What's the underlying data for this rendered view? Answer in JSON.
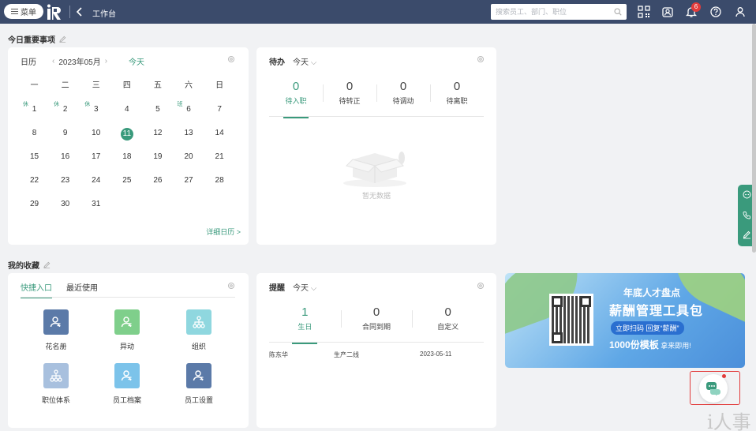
{
  "topbar": {
    "menu_label": "菜单",
    "breadcrumb": "工作台",
    "search_placeholder": "搜索员工、部门、职位",
    "notification_count": "6"
  },
  "sections": {
    "important": "今日重要事项",
    "favorites": "我的收藏"
  },
  "calendar": {
    "title": "日历",
    "month": "2023年05月",
    "today_label": "今天",
    "weekdays": [
      "一",
      "二",
      "三",
      "四",
      "五",
      "六",
      "日"
    ],
    "weeks": [
      [
        {
          "d": "1",
          "tag": "休"
        },
        {
          "d": "2",
          "tag": "休"
        },
        {
          "d": "3",
          "tag": "休"
        },
        {
          "d": "4"
        },
        {
          "d": "5"
        },
        {
          "d": "6",
          "tag": "班"
        },
        {
          "d": "7"
        }
      ],
      [
        {
          "d": "8"
        },
        {
          "d": "9"
        },
        {
          "d": "10"
        },
        {
          "d": "11",
          "today": true
        },
        {
          "d": "12"
        },
        {
          "d": "13"
        },
        {
          "d": "14"
        }
      ],
      [
        {
          "d": "15"
        },
        {
          "d": "16"
        },
        {
          "d": "17"
        },
        {
          "d": "18"
        },
        {
          "d": "19"
        },
        {
          "d": "20"
        },
        {
          "d": "21"
        }
      ],
      [
        {
          "d": "22"
        },
        {
          "d": "23"
        },
        {
          "d": "24"
        },
        {
          "d": "25"
        },
        {
          "d": "26"
        },
        {
          "d": "27"
        },
        {
          "d": "28"
        }
      ],
      [
        {
          "d": "29"
        },
        {
          "d": "30"
        },
        {
          "d": "31"
        }
      ]
    ],
    "detail_link": "详细日历 >"
  },
  "todo": {
    "title": "待办",
    "filter": "今天",
    "stats": [
      {
        "n": "0",
        "label": "待入职",
        "active": true
      },
      {
        "n": "0",
        "label": "待转正"
      },
      {
        "n": "0",
        "label": "待调动"
      },
      {
        "n": "0",
        "label": "待离职"
      }
    ],
    "empty_text": "暂无数据"
  },
  "favorites": {
    "tabs": [
      "快捷入口",
      "最近使用"
    ],
    "tiles": [
      {
        "label": "花名册",
        "color": "#5b7aa8",
        "icon": "person-icon"
      },
      {
        "label": "异动",
        "color": "#7fcf8b",
        "icon": "person-transfer-icon"
      },
      {
        "label": "组织",
        "color": "#8fd7df",
        "icon": "org-tree-icon"
      },
      {
        "label": "职位体系",
        "color": "#a8c0de",
        "icon": "position-tree-icon"
      },
      {
        "label": "员工档案",
        "color": "#7cc3ea",
        "icon": "employee-file-icon"
      },
      {
        "label": "员工设置",
        "color": "#5b7aa8",
        "icon": "employee-settings-icon"
      }
    ]
  },
  "reminder": {
    "title": "提醒",
    "filter": "今天",
    "stats": [
      {
        "n": "1",
        "label": "生日",
        "active": true
      },
      {
        "n": "0",
        "label": "合同到期"
      },
      {
        "n": "0",
        "label": "自定义"
      }
    ],
    "row": {
      "name": "陈东华",
      "dept": "生产二线",
      "date": "2023-05-11"
    }
  },
  "banner": {
    "line1": "年底人才盘点",
    "line2": "薪酬管理工具包",
    "line3": "立即扫码 回复“薪酬”",
    "line4_big": "1000份模板",
    "line4_small": " 拿来即用!"
  },
  "watermark": "i人事"
}
